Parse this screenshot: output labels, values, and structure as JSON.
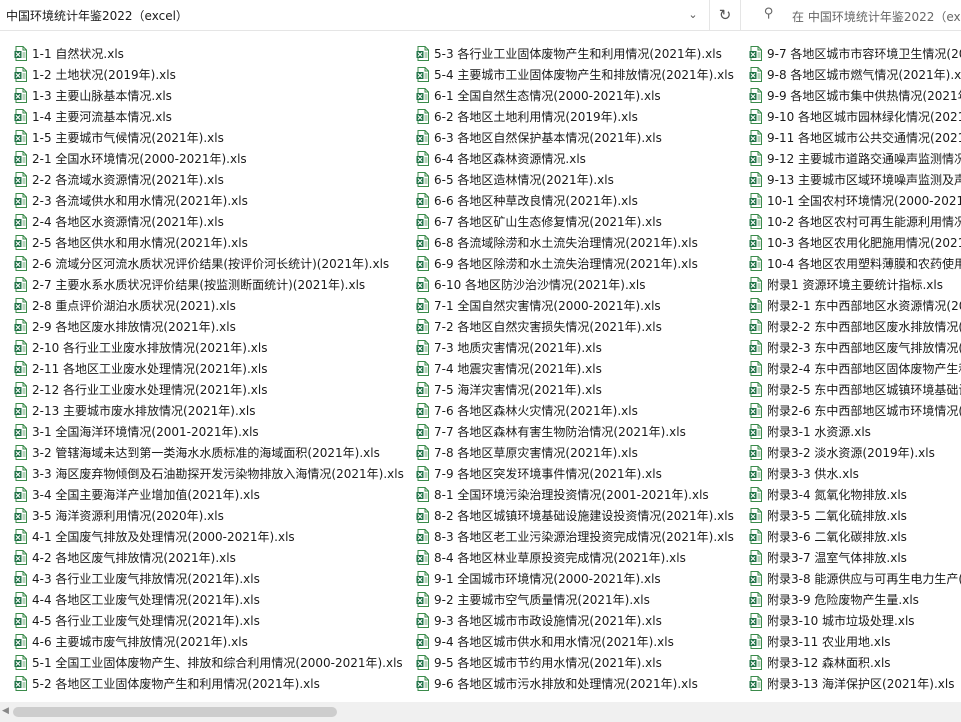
{
  "address_bar": {
    "path": "中国环境统计年鉴2022（excel）"
  },
  "search": {
    "placeholder": "在 中国环境统计年鉴2022（exc"
  },
  "icons": {
    "history": "chevron-down-icon",
    "refresh": "refresh-icon",
    "search": "search-icon",
    "file": "excel-file-icon"
  },
  "colors": {
    "excel_green": "#1e7145",
    "scroll_thumb": "#cdcdcd"
  },
  "files": {
    "col1": [
      "1-1 自然状况.xls",
      "1-2 土地状况(2019年).xls",
      "1-3 主要山脉基本情况.xls",
      "1-4 主要河流基本情况.xls",
      "1-5 主要城市气候情况(2021年).xls",
      "2-1 全国水环境情况(2000-2021年).xls",
      "2-2 各流域水资源情况(2021年).xls",
      "2-3 各流域供水和用水情况(2021年).xls",
      "2-4 各地区水资源情况(2021年).xls",
      "2-5 各地区供水和用水情况(2021年).xls",
      "2-6 流域分区河流水质状况评价结果(按评价河长统计)(2021年).xls",
      "2-7 主要水系水质状况评价结果(按监测断面统计)(2021年).xls",
      "2-8 重点评价湖泊水质状况(2021).xls",
      "2-9 各地区废水排放情况(2021年).xls",
      "2-10 各行业工业废水排放情况(2021年).xls",
      "2-11 各地区工业废水处理情况(2021年).xls",
      "2-12 各行业工业废水处理情况(2021年).xls",
      "2-13 主要城市废水排放情况(2021年).xls",
      "3-1 全国海洋环境情况(2001-2021年).xls",
      "3-2 管辖海域未达到第一类海水水质标准的海域面积(2021年).xls",
      "3-3 海区废弃物倾倒及石油勘探开发污染物排放入海情况(2021年).xls",
      "3-4 全国主要海洋产业增加值(2021年).xls",
      "3-5 海洋资源利用情况(2020年).xls",
      "4-1 全国废气排放及处理情况(2000-2021年).xls",
      "4-2 各地区废气排放情况(2021年).xls",
      "4-3 各行业工业废气排放情况(2021年).xls",
      "4-4 各地区工业废气处理情况(2021年).xls",
      "4-5 各行业工业废气处理情况(2021年).xls",
      "4-6 主要城市废气排放情况(2021年).xls",
      "5-1 全国工业固体废物产生、排放和综合利用情况(2000-2021年).xls",
      "5-2 各地区工业固体废物产生和利用情况(2021年).xls"
    ],
    "col2": [
      "5-3 各行业工业固体废物产生和利用情况(2021年).xls",
      "5-4 主要城市工业固体废物产生和排放情况(2021年).xls",
      "6-1 全国自然生态情况(2000-2021年).xls",
      "6-2 各地区土地利用情况(2019年).xls",
      "6-3 各地区自然保护基本情况(2021年).xls",
      "6-4 各地区森林资源情况.xls",
      "6-5 各地区造林情况(2021年).xls",
      "6-6 各地区种草改良情况(2021年).xls",
      "6-7 各地区矿山生态修复情况(2021年).xls",
      "6-8 各流域除涝和水土流失治理情况(2021年).xls",
      "6-9 各地区除涝和水土流失治理情况(2021年).xls",
      "6-10 各地区防沙治沙情况(2021年).xls",
      "7-1 全国自然灾害情况(2000-2021年).xls",
      "7-2 各地区自然灾害损失情况(2021年).xls",
      "7-3 地质灾害情况(2021年).xls",
      "7-4 地震灾害情况(2021年).xls",
      "7-5 海洋灾害情况(2021年).xls",
      "7-6 各地区森林火灾情况(2021年).xls",
      "7-7 各地区森林有害生物防治情况(2021年).xls",
      "7-8 各地区草原灾害情况(2021年).xls",
      "7-9 各地区突发环境事件情况(2021年).xls",
      "8-1 全国环境污染治理投资情况(2001-2021年).xls",
      "8-2 各地区城镇环境基础设施建设投资情况(2021年).xls",
      "8-3 各地区老工业污染源治理投资完成情况(2021年).xls",
      "8-4 各地区林业草原投资完成情况(2021年).xls",
      "9-1 全国城市环境情况(2000-2021年).xls",
      "9-2 主要城市空气质量情况(2021年).xls",
      "9-3 各地区城市市政设施情况(2021年).xls",
      "9-4 各地区城市供水和用水情况(2021年).xls",
      "9-5 各地区城市节约用水情况(2021年).xls",
      "9-6 各地区城市污水排放和处理情况(2021年).xls"
    ],
    "col3": [
      "9-7 各地区城市市容环境卫生情况(20",
      "9-8 各地区城市燃气情况(2021年).xls",
      "9-9 各地区城市集中供热情况(2021年",
      "9-10 各地区城市园林绿化情况(2021年",
      "9-11 各地区城市公共交通情况(2021年",
      "9-12 主要城市道路交通噪声监测情况",
      "9-13 主要城市区域环境噪声监测及声",
      "10-1 全国农村环境情况(2000-2021年",
      "10-2 各地区农村可再生能源利用情况",
      "10-3 各地区农用化肥施用情况(2021年",
      "10-4 各地区农用塑料薄膜和农药使用",
      "附录1 资源环境主要统计指标.xls",
      "附录2-1 东中西部地区水资源情况(20",
      "附录2-2 东中西部地区废水排放情况(",
      "附录2-3 东中西部地区废气排放情况(",
      "附录2-4 东中西部地区固体废物产生和",
      "附录2-5 东中西部地区城镇环境基础设",
      "附录2-6 东中西部地区城市环境情况(",
      "附录3-1 水资源.xls",
      "附录3-2 淡水资源(2019年).xls",
      "附录3-3 供水.xls",
      "附录3-4 氮氧化物排放.xls",
      "附录3-5 二氧化硫排放.xls",
      "附录3-6 二氧化碳排放.xls",
      "附录3-7 温室气体排放.xls",
      "附录3-8 能源供应与可再生电力生产(",
      "附录3-9 危险废物产生量.xls",
      "附录3-10 城市垃圾处理.xls",
      "附录3-11 农业用地.xls",
      "附录3-12 森林面积.xls",
      "附录3-13 海洋保护区(2021年).xls"
    ]
  }
}
